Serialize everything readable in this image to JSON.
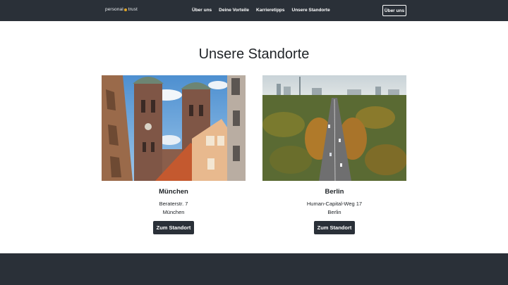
{
  "nav": {
    "brand_left": "personal",
    "brand_right": "trust",
    "links": [
      "Über uns",
      "Deine Vorteile",
      "Karrieretipps",
      "Unsere Standorte"
    ],
    "button": "Über uns"
  },
  "section": {
    "title": "Unsere Standorte"
  },
  "locations": [
    {
      "city": "München",
      "street": "Beraterstr. 7",
      "town": "München",
      "button": "Zum Standort"
    },
    {
      "city": "Berlin",
      "street": "Human-Capital-Weg 17",
      "town": "Berlin",
      "button": "Zum Standort"
    }
  ],
  "colors": {
    "dark": "#2a3038",
    "accent": "#e0a526"
  }
}
